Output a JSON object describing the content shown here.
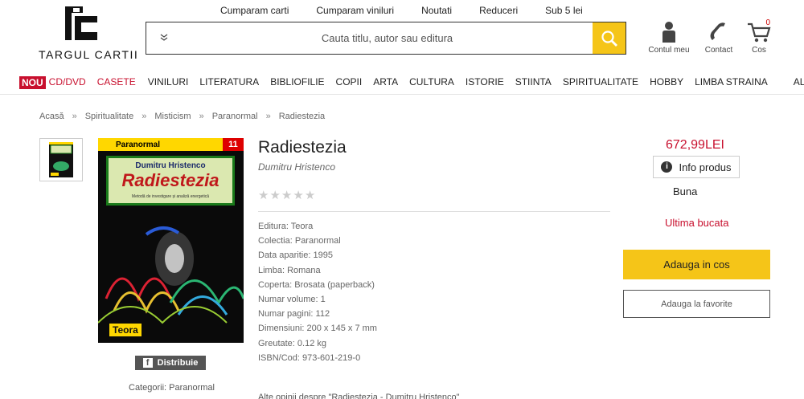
{
  "top_links": [
    "Cumparam carti",
    "Cumparam viniluri",
    "Noutati",
    "Reduceri",
    "Sub 5 lei"
  ],
  "logo": {
    "text": "TARGUL CARTII"
  },
  "search": {
    "placeholder": "Cauta titlu, autor sau editura"
  },
  "header_icons": {
    "account_label": "Contul meu",
    "contact_label": "Contact",
    "cart_label": "Cos",
    "cart_count": "0"
  },
  "categories": {
    "nou": "NOU",
    "cd": "CD/DVD",
    "casete": "CASETE",
    "items": [
      "VINILURI",
      "LITERATURA",
      "BIBLIOFILIE",
      "COPII",
      "ARTA",
      "CULTURA",
      "ISTORIE",
      "STIINTA",
      "SPIRITUALITATE",
      "HOBBY",
      "LIMBA STRAINA"
    ],
    "last": "ALTELE"
  },
  "breadcrumb": {
    "items": [
      "Acasă",
      "Spiritualitate",
      "Misticism",
      "Paranormal",
      "Radiestezia"
    ],
    "separator": "»"
  },
  "cover": {
    "series": "Paranormal",
    "number": "11",
    "author": "Dumitru Hristenco",
    "title": "Radiestezia",
    "subtitle": "Metodă de investigare și analiză energetică",
    "publisher": "Teora"
  },
  "share": {
    "label": "Distribuie"
  },
  "category_line": "Categorii: Paranormal",
  "product": {
    "title": "Radiestezia",
    "author": "Dumitru Hristenco",
    "rating_stars": 0,
    "details": [
      "Editura: Teora",
      "Colectia: Paranormal",
      "Data aparitie: 1995",
      "Limba: Romana",
      "Coperta: Brosata (paperback)",
      "Numar volume: 1",
      "Numar pagini: 112",
      "Dimensiuni: 200 x 145 x 7 mm",
      "Greutate: 0.12 kg",
      "ISBN/Cod: 973-601-219-0"
    ]
  },
  "purchase": {
    "price": "672,99LEI",
    "info_label": "Info produs",
    "condition": "Buna",
    "stock": "Ultima bucata",
    "add_cart": "Adauga in cos",
    "add_favorite": "Adauga la favorite"
  },
  "also_text": "Alte opinii despre \"Radiestezia - Dumitru Hristenco\"",
  "colors": {
    "accent": "#f5c518",
    "brand_red": "#c8102e"
  }
}
